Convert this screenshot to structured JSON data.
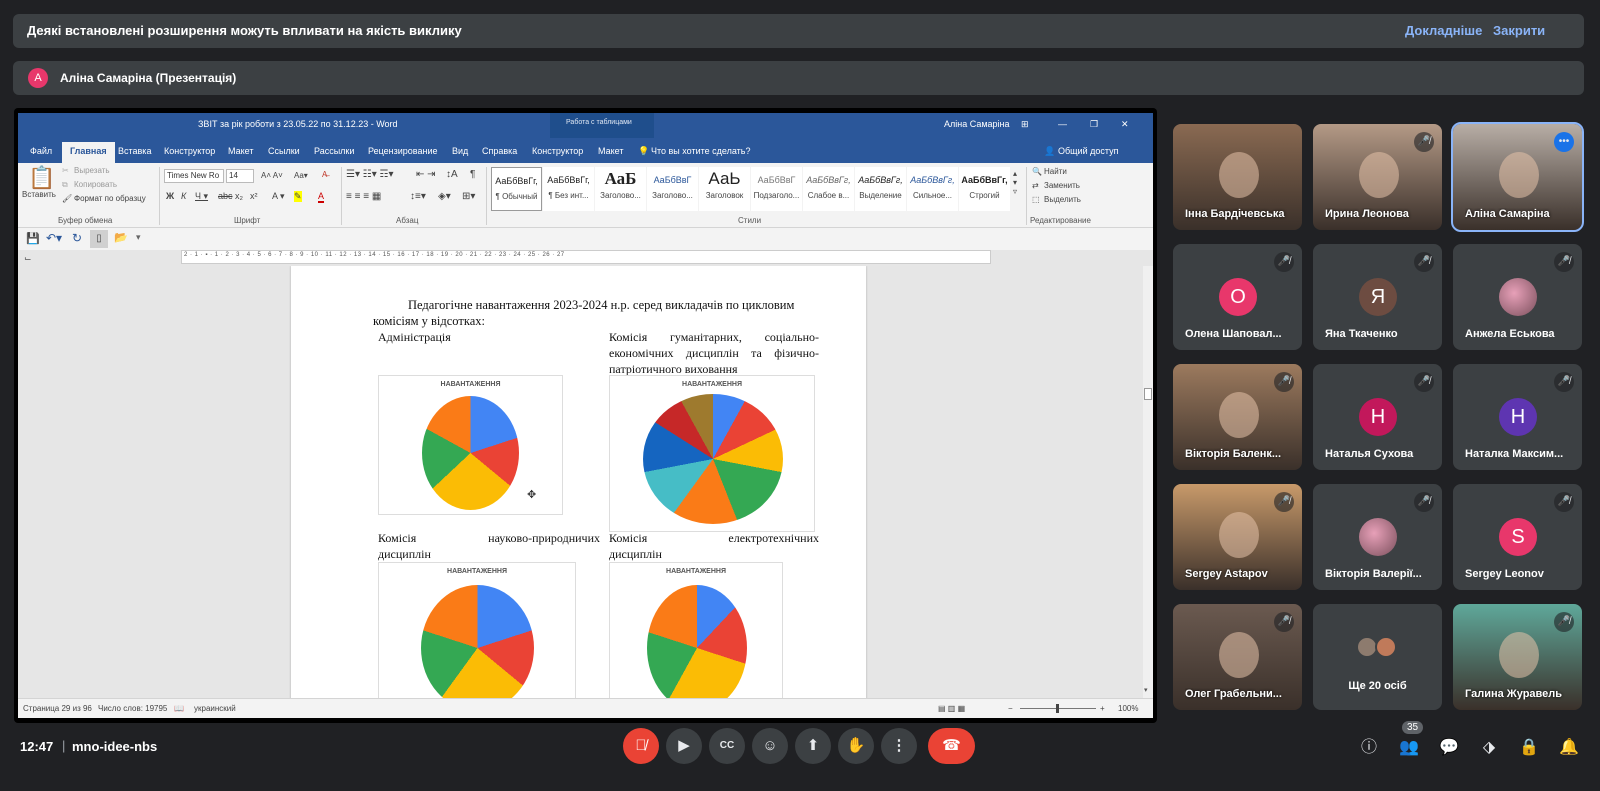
{
  "notice": {
    "message": "Деякі встановлені розширення можуть впливати на якість виклику",
    "more_label": "Докладніше",
    "close_label": "Закрити"
  },
  "presenter": {
    "initial": "А",
    "name": "Аліна Самаріна (Презентація)"
  },
  "word": {
    "title": "ЗВІТ за рік роботи з 23.05.22 по 31.12.23  -  Word",
    "context_tab": "Работа с таблицами",
    "user": "Аліна Самаріна",
    "tabs": [
      "Файл",
      "Главная",
      "Вставка",
      "Конструктор",
      "Макет",
      "Ссылки",
      "Рассылки",
      "Рецензирование",
      "Вид",
      "Справка",
      "Конструктор",
      "Макет"
    ],
    "tell_me": "Что вы хотите сделать?",
    "share": "Общий доступ",
    "ribbon": {
      "paste": "Вставить",
      "cut": "Вырезать",
      "copy": "Копировать",
      "format_painter": "Формат по образцу",
      "font_name": "Times New Ro",
      "font_size": "14",
      "find": "Найти",
      "replace": "Заменить",
      "select": "Выделить",
      "groups": {
        "clipboard": "Буфер обмена",
        "font": "Шрифт",
        "paragraph": "Абзац",
        "styles": "Стили",
        "editing": "Редактирование"
      },
      "styles": [
        {
          "preview": "АаБбВвГг,",
          "name": "¶ Обычный"
        },
        {
          "preview": "АаБбВвГг,",
          "name": "¶ Без инт..."
        },
        {
          "preview": "АаБ",
          "name": "Заголово..."
        },
        {
          "preview": "АаБбВвГ",
          "name": "Заголово..."
        },
        {
          "preview": "АаЬ",
          "name": "Заголовок"
        },
        {
          "preview": "АаБбВвГ",
          "name": "Подзаголо..."
        },
        {
          "preview": "АаБбВвГг,",
          "name": "Слабое в..."
        },
        {
          "preview": "АаБбВвГг,",
          "name": "Выделение"
        },
        {
          "preview": "АаБбВвГг,",
          "name": "Сильное..."
        },
        {
          "preview": "АаБбВвГг,",
          "name": "Строгий"
        }
      ]
    },
    "ruler": "2 · 1 · ▪ · 1 · 2 · 3 · 4 · 5 · 6 · 7 · 8 · 9 · 10 · 11 · 12 · 13 · 14 · 15 · 16 · 17 · 18 · 19 · 20 · 21 · 22 · 23 · 24 · 25 · 26 · 27",
    "document": {
      "heading_line1": "Педагогічне навантаження 2023-2024 н.р. серед викладачів по цикловим",
      "heading_line2": "комісіям у відсотках:",
      "col1_title": "Адміністрація",
      "col2_title_l1": "Комісія гуманітарних, соціально-",
      "col2_title_l2": "економічних дисциплін та фізично-",
      "col2_title_l3": "патріотичного виховання",
      "col1_title_b_l1": "Комісія науково-природничих",
      "col1_title_b_l2": "дисциплін",
      "col2_title_b_l1": "Комісія електротехнічних",
      "col2_title_b_l2": "дисциплін",
      "chart_title": "НАВАНТАЖЕННЯ"
    },
    "status": {
      "page": "Страница 29 из 96",
      "words": "Число слов: 19795",
      "lang": "украинский",
      "zoom": "100%"
    }
  },
  "participants": [
    {
      "name": "Інна Бардічевська",
      "type": "video",
      "muted": false,
      "bg": "#8a6a52"
    },
    {
      "name": "Ирина Леонова",
      "type": "video",
      "muted": true,
      "bg": "#b49a86"
    },
    {
      "name": "Аліна Самаріна",
      "type": "video",
      "muted": false,
      "speaking": true,
      "bg": "#b8aea6"
    },
    {
      "name": "Олена Шаповал...",
      "initial": "О",
      "type": "avatar",
      "muted": true,
      "color": "#e8376b"
    },
    {
      "name": "Яна Ткаченко",
      "initial": "Я",
      "type": "avatar",
      "muted": true,
      "color": "#6d4c41"
    },
    {
      "name": "Анжела Еськова",
      "type": "photo",
      "muted": true,
      "bg": "#5f6368"
    },
    {
      "name": "Вікторія Баленк...",
      "type": "video",
      "muted": true,
      "bg": "#9c7a5e"
    },
    {
      "name": "Наталья Сухова",
      "initial": "Н",
      "type": "avatar",
      "muted": true,
      "color": "#c2185b"
    },
    {
      "name": "Наталка Максим...",
      "initial": "Н",
      "type": "avatar",
      "muted": true,
      "color": "#5e35b1"
    },
    {
      "name": "Sergey Astapov",
      "type": "video",
      "muted": true,
      "bg": "#c89a6a"
    },
    {
      "name": "Вікторія Валерії...",
      "type": "photo",
      "muted": true,
      "bg": "#5f6368"
    },
    {
      "name": "Sergey Leonov",
      "initial": "S",
      "type": "avatar",
      "muted": true,
      "color": "#e8376b"
    },
    {
      "name": "Олег Грабельни...",
      "type": "video",
      "muted": true,
      "bg": "#6b5a50"
    },
    {
      "name": "Ще 20 осіб",
      "type": "more",
      "muted": false
    },
    {
      "name": "Галина Журавель",
      "type": "video",
      "muted": true,
      "bg": "#5fa89a"
    }
  ],
  "bottom": {
    "time": "12:47",
    "meeting_code": "mno-idee-nbs",
    "participant_count": "35"
  },
  "colors": {
    "accent": "#8ab4f8",
    "end_call": "#ea4335",
    "word_blue": "#2b579a"
  }
}
